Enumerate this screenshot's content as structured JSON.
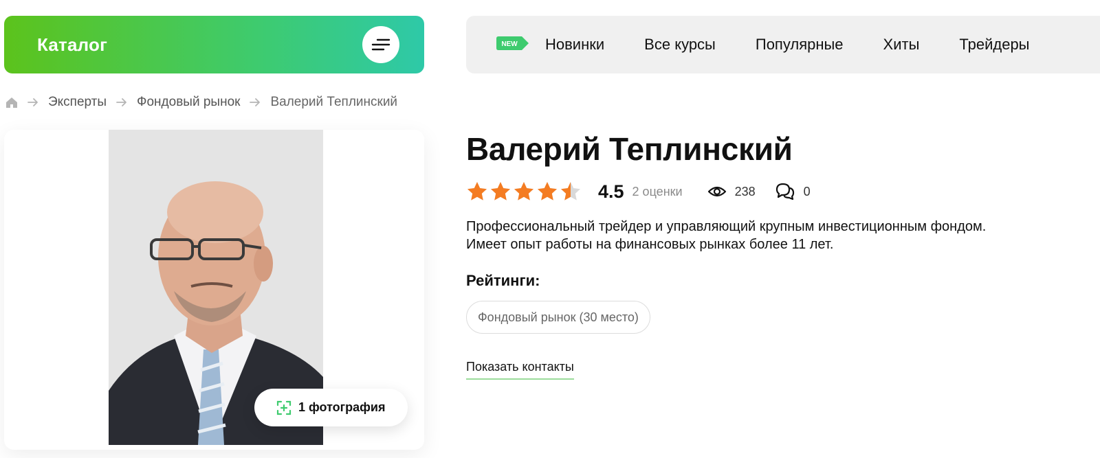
{
  "catalog": {
    "label": "Каталог",
    "menu_icon": "sort-lines-icon"
  },
  "topnav": {
    "badge": "NEW",
    "items": [
      "Новинки",
      "Все курсы",
      "Популярные",
      "Хиты",
      "Трейдеры"
    ]
  },
  "breadcrumb": {
    "home_icon": "home-icon",
    "items": [
      "Эксперты",
      "Фондовый рынок",
      "Валерий Теплинский"
    ]
  },
  "photo": {
    "badge_label": "1 фотография",
    "badge_icon": "image-expand-icon"
  },
  "expert": {
    "name": "Валерий Теплинский",
    "rating": {
      "stars_filled": 4.5,
      "stars_max": 5,
      "value": "4.5",
      "count_label": "2 оценки"
    },
    "views": "238",
    "comments": "0",
    "description_lines": [
      "Профессиональный трейдер и управляющий крупным инвестиционным фондом.",
      "Имеет опыт работы на финансовых рынках более 11 лет."
    ],
    "ratings_title": "Рейтинги:",
    "ratings": [
      "Фондовый рынок (30 место)"
    ],
    "contacts_label": "Показать контакты"
  },
  "colors": {
    "accent_green": "#3ecb6e",
    "star_orange": "#f47c22",
    "nav_bg": "#f0f0f0"
  }
}
